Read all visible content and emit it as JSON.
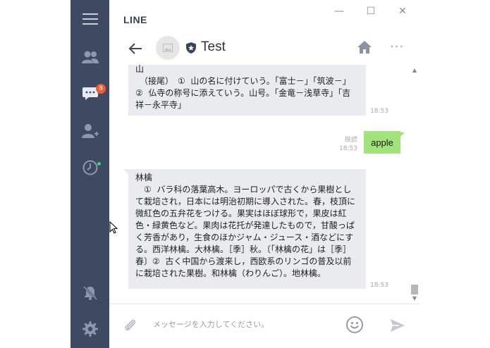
{
  "app": {
    "name": "LINE"
  },
  "window_controls": {
    "minimize": "—",
    "maximize": "☐",
    "close": "✕"
  },
  "rail": {
    "items": [
      {
        "icon": "hamburger-menu-icon"
      },
      {
        "icon": "friends-icon"
      },
      {
        "icon": "chats-icon",
        "badge": "8"
      },
      {
        "icon": "add-friend-icon"
      },
      {
        "icon": "timeline-icon"
      },
      {
        "icon": "notifications-off-icon"
      },
      {
        "icon": "settings-icon"
      }
    ]
  },
  "chat": {
    "title": "Test",
    "more_label": "···"
  },
  "messages": [
    {
      "direction": "in",
      "text": "山\n　（接尾）　①  山の名に付けていう。「富士－」「筑波－」\n②  仏寺の称号に添えていう。山号。「金竜－浅草寺」「吉祥－永平寺」",
      "time": "18:53"
    },
    {
      "direction": "out",
      "text": "apple",
      "read": "既読",
      "time": "18:53"
    },
    {
      "direction": "in",
      "text": "林檎\n　①  バラ科の落葉高木。ヨーロッパで古くから果樹として栽培され，日本には明治初期に導入された。春，枝頂に微紅色の五弁花をつける。果実はほぼ球形で，果皮は紅色・緑黄色など。果肉は花托が発達したもので，甘酸っぱく芳香があり，生食のほかジャム・ジュース・酒などにする。西洋林檎。大林檎。［季］秋。〔「林檎の花」は［季］春〕②  古く中国から渡来し，西欧系のリンゴの普及以前に栽培された果樹。和林檎（わりんご）。地林檎。",
      "time": "18:53"
    }
  ],
  "composer": {
    "placeholder": "メッセージを入力してください。",
    "value": ""
  },
  "colors": {
    "rail_bg": "#3f4a62",
    "incoming_bubble": "#e9ebef",
    "outgoing_bubble": "#a3e37c",
    "badge": "#f25b3a"
  }
}
